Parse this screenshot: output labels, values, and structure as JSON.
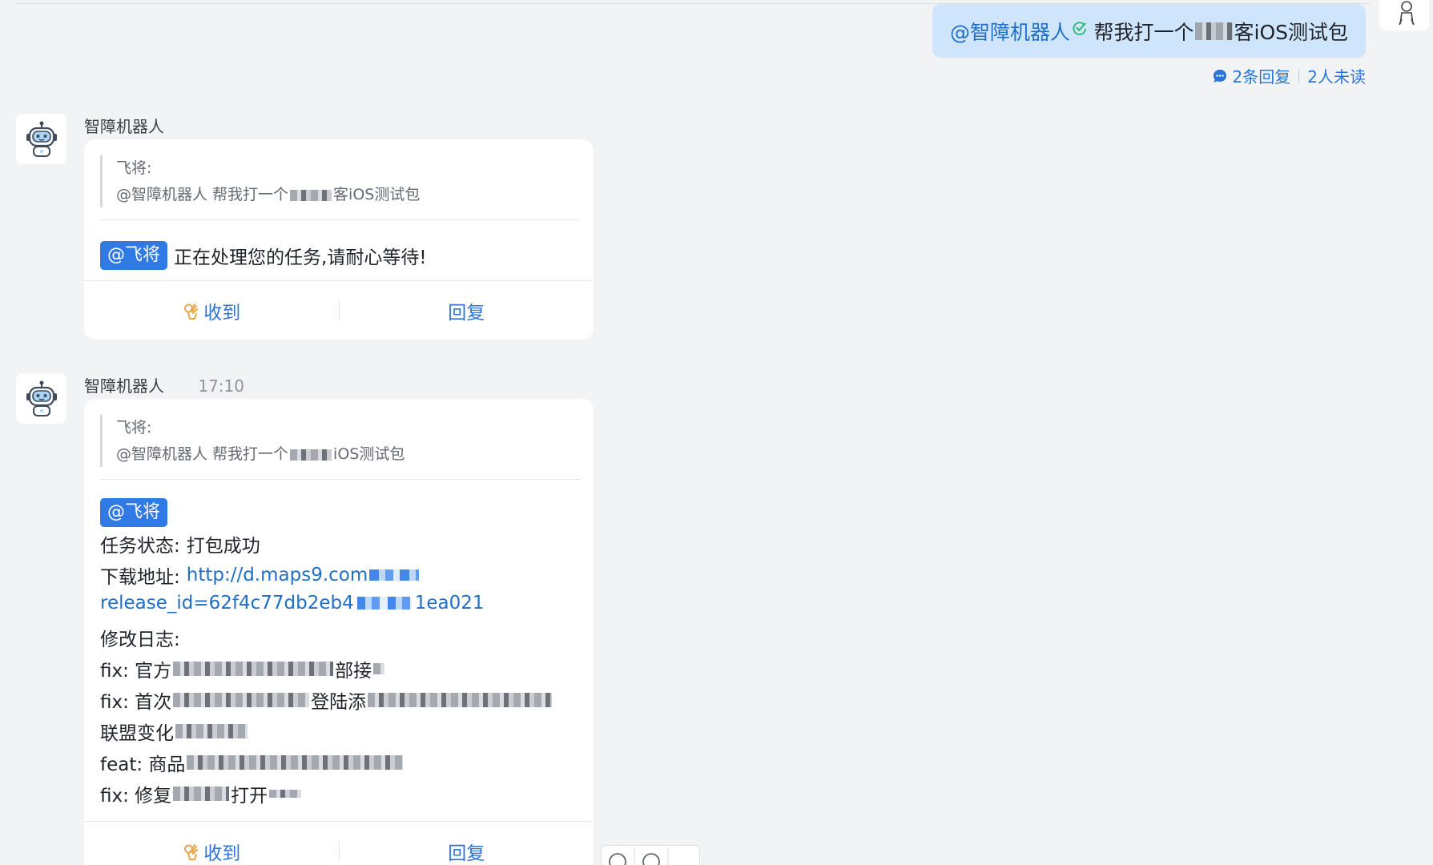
{
  "outgoing": {
    "mention": "@智障机器人",
    "text_before": "帮我打一个",
    "text_after": "客iOS测试包",
    "replies": "2条回复",
    "unread": "2人未读"
  },
  "messages": [
    {
      "sender": "智障机器人",
      "time": "",
      "quote_author": "飞将:",
      "quote_prefix": "@智障机器人  帮我打一个",
      "quote_suffix": "客iOS测试包",
      "mention": "@飞将",
      "body": "正在处理您的任务,请耐心等待!",
      "actions": {
        "ack": "收到",
        "reply": "回复"
      }
    },
    {
      "sender": "智障机器人",
      "time": "17:10",
      "quote_author": "飞将:",
      "quote_prefix": "@智障机器人  帮我打一个",
      "quote_suffix": "iOS测试包",
      "mention": "@飞将",
      "status_label": "任务状态:",
      "status_value": "打包成功",
      "download_label": "下载地址:",
      "download_link_1": "http://d.maps9.com",
      "download_link_2a": "release_id=62f4c77db2eb4",
      "download_link_2b": "1ea021",
      "changelog_label": "修改日志:",
      "changelog": [
        {
          "prefix": "fix: 官方",
          "suffix": "部接"
        },
        {
          "prefix": "fix: 首次",
          "suffix": "登陆添"
        },
        {
          "prefix": "联盟变化",
          "suffix": ""
        },
        {
          "prefix": "feat: 商品",
          "suffix": ""
        },
        {
          "prefix": "fix: 修复",
          "suffix": "打开"
        }
      ],
      "actions": {
        "ack": "收到",
        "reply": "回复"
      }
    }
  ]
}
